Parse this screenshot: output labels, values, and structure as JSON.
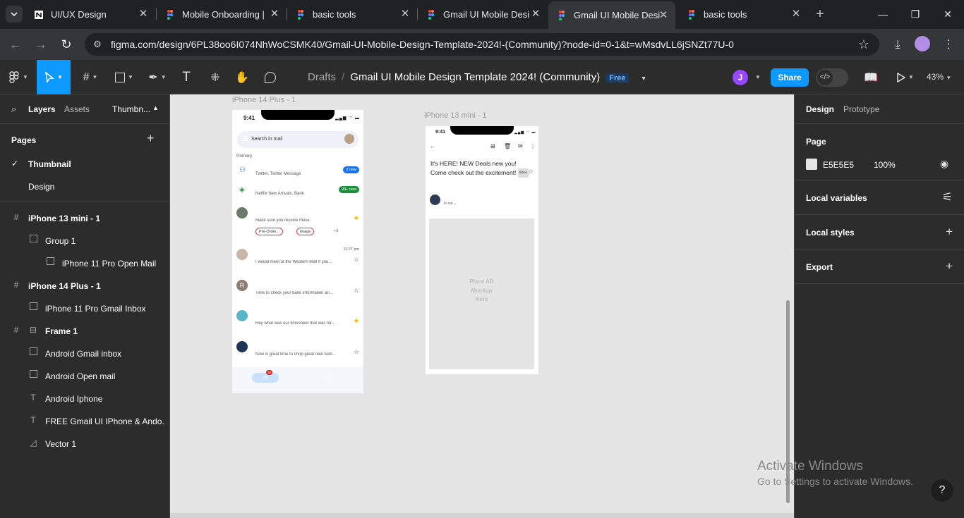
{
  "browser": {
    "tabs": [
      {
        "title": "UI/UX Design",
        "favicon": "notion-icon"
      },
      {
        "title": "Mobile Onboarding |",
        "favicon": "figma-icon"
      },
      {
        "title": "basic tools",
        "favicon": "figma-icon"
      },
      {
        "title": "Gmail UI Mobile Desi",
        "favicon": "figma-icon"
      },
      {
        "title": "Gmail UI Mobile Desi",
        "favicon": "figma-icon",
        "active": true
      },
      {
        "title": "basic tools",
        "favicon": "figma-icon"
      }
    ],
    "url": "figma.com/design/6PL38oo6I074NhWoCSMK40/Gmail-UI-Mobile-Design-Template-2024!-(Community)?node-id=0-1&t=wMsdvLL6jSNZt77U-0"
  },
  "toolbar": {
    "breadcrumb_root": "Drafts",
    "file_name": "Gmail UI Mobile Design Template 2024! (Community)",
    "plan_badge": "Free",
    "avatar_initial": "J",
    "share_label": "Share",
    "zoom": "43%"
  },
  "left_panel": {
    "tab_layers": "Layers",
    "tab_assets": "Assets",
    "tab_page": "Thumbn...",
    "pages_label": "Pages",
    "pages": [
      {
        "name": "Thumbnail",
        "selected": true
      },
      {
        "name": "Design",
        "selected": false
      }
    ],
    "layers": [
      {
        "name": "iPhone 13 mini - 1",
        "icon": "frame-hash-icon",
        "indent": 0,
        "frame": true
      },
      {
        "name": "Group 1",
        "icon": "group-dashed-icon",
        "indent": 1
      },
      {
        "name": "iPhone 11 Pro Open Mail",
        "icon": "image-icon",
        "indent": 2
      },
      {
        "name": "iPhone 14 Plus - 1",
        "icon": "frame-hash-icon",
        "indent": 0,
        "frame": true
      },
      {
        "name": "iPhone 11 Pro Gmail Inbox",
        "icon": "image-icon",
        "indent": 1
      },
      {
        "name": "Frame 1",
        "icon": "frame-hash-icon",
        "indent": 0,
        "frame": true
      },
      {
        "name": "Android Gmail inbox",
        "icon": "image-icon",
        "indent": 1
      },
      {
        "name": "Android Open mail",
        "icon": "image-icon",
        "indent": 1
      },
      {
        "name": "Android Iphone",
        "icon": "text-icon",
        "indent": 1
      },
      {
        "name": "FREE Gmail UI IPhone & Ando...",
        "icon": "text-icon",
        "indent": 1
      },
      {
        "name": "Vector 1",
        "icon": "vector-icon",
        "indent": 1
      }
    ]
  },
  "right_panel": {
    "tab_design": "Design",
    "tab_prototype": "Prototype",
    "page_label": "Page",
    "page_color_hex": "E5E5E5",
    "page_opacity": "100%",
    "sections": [
      "Local variables",
      "Local styles",
      "Export"
    ]
  },
  "canvas": {
    "frame1_label": "iPhone 14 Plus - 1",
    "frame2_label": "iPhone 13 mini - 1",
    "inbox": {
      "time": "9:41",
      "search_placeholder": "Search in mail",
      "section": "Primary",
      "categories": [
        {
          "name": "Social",
          "sub": "Twitter, Twitter Message",
          "badge": "2 new",
          "badge_color": "#1a73e8",
          "icon": "people-icon"
        },
        {
          "name": "Promotions",
          "sub": "Netflix New Arrivals, Bank",
          "badge": "99+ new",
          "badge_color": "#1e8e3e",
          "icon": "tag-icon"
        }
      ],
      "emails": [
        {
          "sender": "Fortune Company co.",
          "subject": "Important Files!",
          "snippet": "Make sure you receive these.",
          "date": "11:27 pm",
          "starred": true,
          "avatar_color": "#6b7b6a",
          "chips": [
            "Pre-Order...",
            "Image"
          ],
          "more": "+3"
        },
        {
          "sender": "Stephanie Everhill",
          "subject": "When do we meet again?",
          "snippet": "I would meet at the Western Mall if you...",
          "date": "11:27 pm",
          "starred": false,
          "avatar_color": "#c9b6a8"
        },
        {
          "sender": "Random Bank Online",
          "subject": "Random Bank Account Balance Update",
          "snippet": "Time to check your bank information an...",
          "date": "June 19",
          "starred": false,
          "avatar_color": "#8d7b72",
          "avatar_letter": "R"
        },
        {
          "sender": "Taylor Grey",
          "subject": "Timesheet nextweek?",
          "snippet": "Hey what was our timesheet that was for...",
          "date": "May 6",
          "starred": true,
          "avatar_color": "#5bb5c8"
        },
        {
          "sender": "UniqueYou by SecretKissShop",
          "subject": "Learn new Tricks",
          "snippet": "Now is great time to shop great new fash...",
          "date": "May 6",
          "starred": false,
          "avatar_color": "#1d3557"
        }
      ],
      "mail_badge": "10"
    },
    "open_mail": {
      "time": "9:41",
      "subject": "It's HERE! NEW Deals new you! Come check out the excitement!",
      "label": "Inbox",
      "sender": "SecretKissShop.com...",
      "date": "May 6",
      "to": "to me ⌄",
      "ad_text": "Place AD Mockup Here"
    }
  },
  "overlay": {
    "activate_title": "Activate Windows",
    "activate_sub": "Go to Settings to activate Windows.",
    "help": "?"
  }
}
